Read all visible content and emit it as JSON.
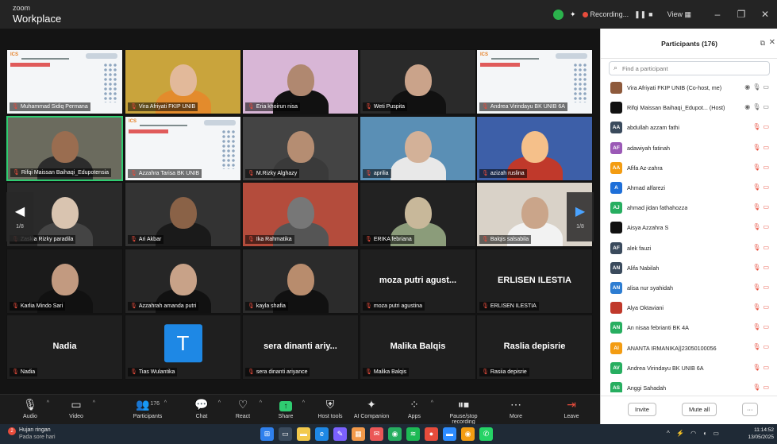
{
  "titlebar": {
    "brand_top": "zoom",
    "brand_bottom": "Workplace",
    "recording_label": "Recording...",
    "view_label": "View",
    "minimize": "–",
    "restore": "❐",
    "close": "✕"
  },
  "video_tiles": [
    {
      "label": "Muhammad Sidiq Permana",
      "type": "slide"
    },
    {
      "label": "Vira Afriyati FKIP UNIB",
      "type": "person",
      "bg": "#c9a43c",
      "face": "#e2b99a",
      "body": "#e38b2c"
    },
    {
      "label": "Eria khoirun nisa",
      "type": "person",
      "bg": "#d8b6d6",
      "face": "#b08870",
      "body": "#111111"
    },
    {
      "label": "Weti Puspita",
      "type": "person",
      "bg": "#2a2a2a",
      "face": "#caa38a",
      "body": "#111111"
    },
    {
      "label": "Andrea Virindayu BK UNIB 6A",
      "type": "slide"
    },
    {
      "label": "Rifqi Maissan Baihaqi_Edupotensia",
      "type": "person",
      "bg": "#6b6b5e",
      "face": "#9a6d50",
      "body": "#2c2c2c",
      "active": true
    },
    {
      "label": "Azzahra Tarisa BK UNIB",
      "type": "slide"
    },
    {
      "label": "M.Rizky Alghazy",
      "type": "person",
      "bg": "#444444",
      "face": "#b58d72",
      "body": "#3a3a3a"
    },
    {
      "label": "aprilia",
      "type": "person",
      "bg": "#5a8fb5",
      "face": "#d3b198",
      "body": "#e8e8e8"
    },
    {
      "label": "azizah ruslina",
      "type": "person",
      "bg": "#3d5fa8",
      "face": "#f5c08a",
      "body": "#c0392b"
    },
    {
      "label": "Zaskia Rizky paradila",
      "type": "person",
      "bg": "#2a2a2a",
      "face": "#d9c4b0",
      "body": "#444444"
    },
    {
      "label": "Ari Akbar",
      "type": "person",
      "bg": "#333333",
      "face": "#8a6247",
      "body": "#1a1a1a"
    },
    {
      "label": "Ika Rahmatika",
      "type": "person",
      "bg": "#b44c3c",
      "face": "#777777",
      "body": "#555555"
    },
    {
      "label": "ERIKA febriana",
      "type": "person",
      "bg": "#222222",
      "face": "#c8b89a",
      "body": "#8b9c7a"
    },
    {
      "label": "Balqis salsabila",
      "type": "person",
      "bg": "#d9d2c8",
      "face": "#caa58a",
      "body": "#f2f2f2"
    },
    {
      "label": "Karlia Mindo Sari",
      "type": "person",
      "bg": "#1a1a1a",
      "face": "#c29a80",
      "body": "#111111"
    },
    {
      "label": "Azzahrah amanda putri",
      "type": "person",
      "bg": "#262626",
      "face": "#c8a288",
      "body": "#111111"
    },
    {
      "label": "kayla shafia",
      "type": "person",
      "bg": "#2b2b2b",
      "face": "#b88c6d",
      "body": "#111111"
    },
    {
      "label": "moza putri agustina",
      "type": "name",
      "big": "moza putri agust..."
    },
    {
      "label": "ERLISEN ILESTIA",
      "type": "name",
      "big": "ERLISEN ILESTIA"
    },
    {
      "label": "Nadia",
      "type": "name",
      "big": "Nadia"
    },
    {
      "label": "Tias Wulantika",
      "type": "avatar",
      "big": "T"
    },
    {
      "label": "sera dinanti ariyance",
      "type": "name",
      "big": "sera dinanti ariy..."
    },
    {
      "label": "Malika Balqis",
      "type": "name",
      "big": "Malika Balqis"
    },
    {
      "label": "Rasiia depisrie",
      "type": "name",
      "big": "Raslia depisrie"
    }
  ],
  "nav": {
    "left_page": "1/8",
    "right_page": "1/8"
  },
  "toolbar": {
    "audio": "Audio",
    "video": "Video",
    "participants": "Participants",
    "participants_count": "176",
    "chat": "Chat",
    "react": "React",
    "share": "Share",
    "host_tools": "Host tools",
    "ai_companion": "AI Companion",
    "apps": "Apps",
    "pause_recording": "Pause/stop recording",
    "more": "More",
    "leave": "Leave"
  },
  "panel": {
    "title": "Participants (176)",
    "search_placeholder": "Find a participant",
    "participants": [
      {
        "name": "Vira Afriyati FKIP UNIB (Co-host, me)",
        "initials": "",
        "color": "#8e5a3c",
        "host": true
      },
      {
        "name": "Rifqi Maissan Baihaqi_Edupot... (Host)",
        "initials": "",
        "color": "#111111",
        "host": true
      },
      {
        "name": "abdullah azzam fathi",
        "initials": "AA",
        "color": "#3a4a5c"
      },
      {
        "name": "adawiyah fatinah",
        "initials": "AF",
        "color": "#9b59b6"
      },
      {
        "name": "Afifa Az-zahra",
        "initials": "AA",
        "color": "#f39c12"
      },
      {
        "name": "Ahmad alfarezi",
        "initials": "A",
        "color": "#1e6fd9"
      },
      {
        "name": "ahmad jidan fathahozza",
        "initials": "AJ",
        "color": "#27ae60"
      },
      {
        "name": "Aisya Azzahra S",
        "initials": "",
        "color": "#111111"
      },
      {
        "name": "alek fauzi",
        "initials": "AF",
        "color": "#3a4a5c"
      },
      {
        "name": "Alifa Nabilah",
        "initials": "AN",
        "color": "#3a4a5c"
      },
      {
        "name": "alisa nur syahidah",
        "initials": "AN",
        "color": "#2d7dd2"
      },
      {
        "name": "Alya Oktaviani",
        "initials": "",
        "color": "#c0392b"
      },
      {
        "name": "An nisaa febrianti BK 4A",
        "initials": "AN",
        "color": "#27ae60"
      },
      {
        "name": "ANANTA IRMANIKA||23050100056",
        "initials": "AI",
        "color": "#f39c12"
      },
      {
        "name": "Andrea Virindayu BK UNIB 6A",
        "initials": "AV",
        "color": "#27ae60"
      },
      {
        "name": "Anggi Sahadah",
        "initials": "AS",
        "color": "#27ae60"
      }
    ],
    "invite": "Invite",
    "mute_all": "Mute all",
    "more": "···"
  },
  "taskbar": {
    "weather_title": "Hujan ringan",
    "weather_sub": "Pada sore hari",
    "time": "11:14:52",
    "date": "13/05/2025"
  }
}
